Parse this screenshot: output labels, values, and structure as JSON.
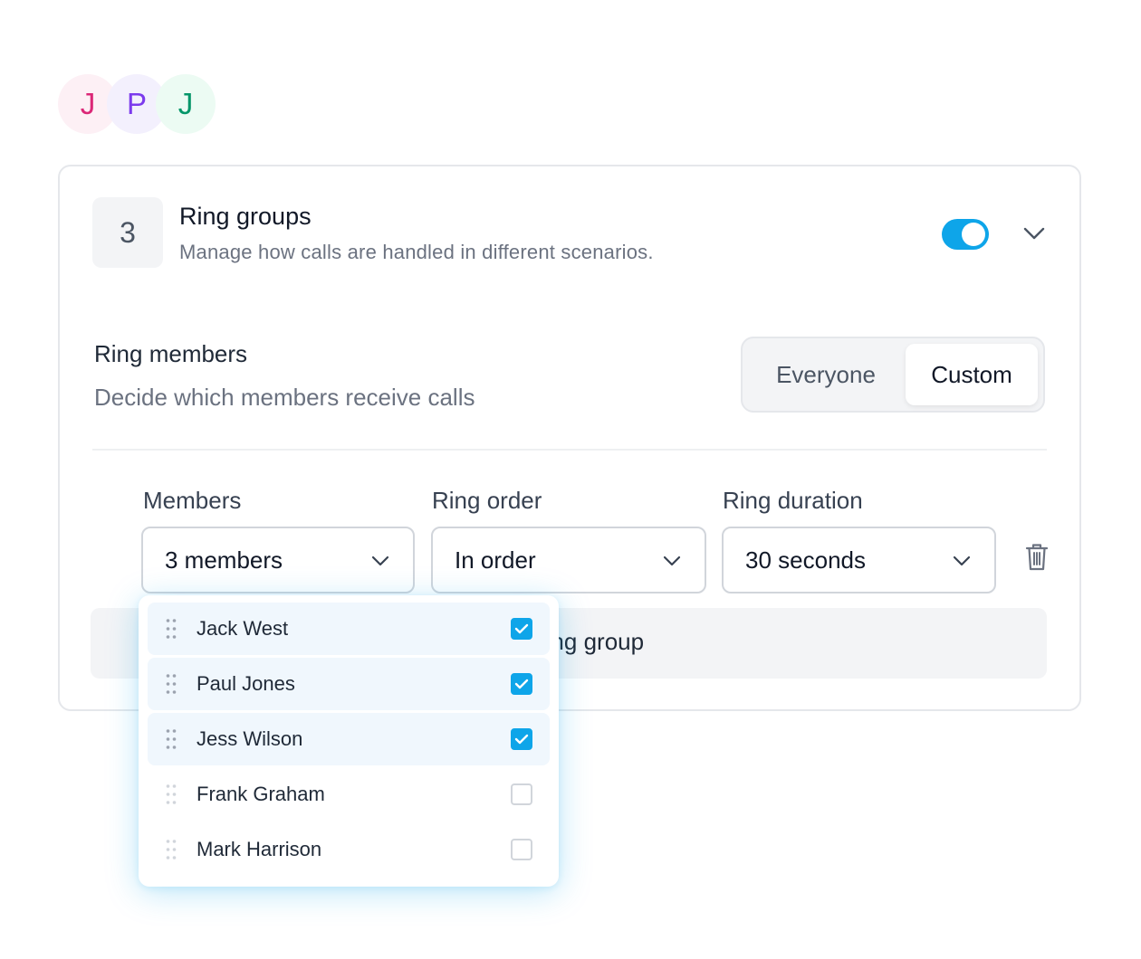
{
  "avatars": [
    {
      "initial": "J",
      "color": "#db2777"
    },
    {
      "initial": "P",
      "color": "#7c3aed"
    },
    {
      "initial": "J",
      "color": "#059669"
    }
  ],
  "card": {
    "step_number": "3",
    "title": "Ring groups",
    "subtitle": "Manage how calls are handled in different scenarios.",
    "enabled": true,
    "toggle_color": "#0ea5e9"
  },
  "ring_members": {
    "title": "Ring members",
    "subtitle": "Decide which members receive calls",
    "options": [
      "Everyone",
      "Custom"
    ],
    "selected": "Custom"
  },
  "fields": {
    "members": {
      "label": "Members",
      "value": "3 members"
    },
    "ring_order": {
      "label": "Ring order",
      "value": "In order"
    },
    "ring_duration": {
      "label": "Ring duration",
      "value": "30 seconds"
    }
  },
  "add_ring_group_label_visible": "ring group",
  "dropdown": {
    "items": [
      {
        "name": "Jack West",
        "checked": true
      },
      {
        "name": "Paul Jones",
        "checked": true
      },
      {
        "name": "Jess Wilson",
        "checked": true
      },
      {
        "name": "Frank Graham",
        "checked": false
      },
      {
        "name": "Mark Harrison",
        "checked": false
      }
    ]
  },
  "icons": {
    "expand": "chevron-down-icon",
    "select": "chevron-down-icon",
    "delete": "trash-icon",
    "drag": "drag-handle-icon",
    "check": "check-icon"
  }
}
